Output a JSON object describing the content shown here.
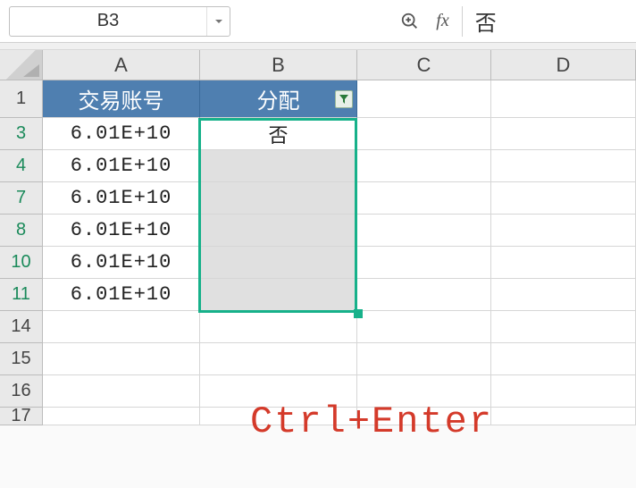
{
  "toolbar": {
    "name_box_value": "B3",
    "formula_value": "否"
  },
  "columns": [
    "A",
    "B",
    "C",
    "D"
  ],
  "header_row": {
    "num": "1",
    "colA": "交易账号",
    "colB": "分配"
  },
  "data_rows": [
    {
      "num": "3",
      "A": "6.01E+10",
      "B": "否",
      "filtered": true,
      "active": true
    },
    {
      "num": "4",
      "A": "6.01E+10",
      "B": "",
      "filtered": true
    },
    {
      "num": "7",
      "A": "6.01E+10",
      "B": "",
      "filtered": true
    },
    {
      "num": "8",
      "A": "6.01E+10",
      "B": "",
      "filtered": true
    },
    {
      "num": "10",
      "A": "6.01E+10",
      "B": "",
      "filtered": true
    },
    {
      "num": "11",
      "A": "6.01E+10",
      "B": "",
      "filtered": true
    }
  ],
  "empty_rows": [
    "14",
    "15",
    "16",
    "17"
  ],
  "annotation": "Ctrl+Enter"
}
